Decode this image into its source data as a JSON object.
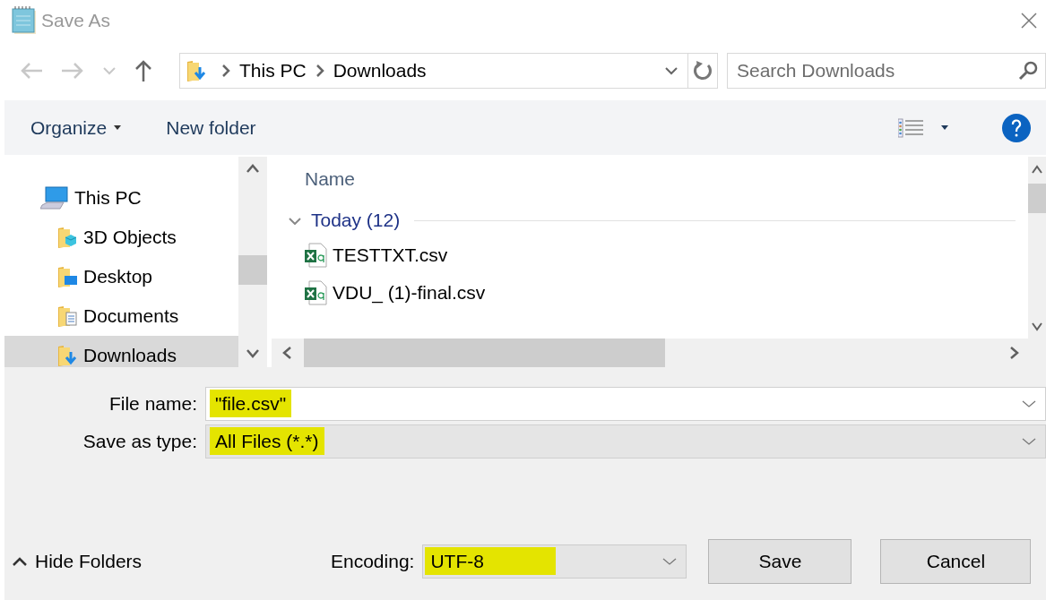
{
  "window": {
    "title": "Save As"
  },
  "address": {
    "path": [
      {
        "label": "This PC"
      },
      {
        "label": "Downloads"
      }
    ]
  },
  "search": {
    "placeholder": "Search Downloads"
  },
  "toolbar": {
    "items": [
      {
        "label": "Organize",
        "has_menu": true
      },
      {
        "label": "New folder",
        "has_menu": false
      }
    ]
  },
  "sidebar": {
    "items": [
      {
        "label": "This PC",
        "kind": "pc",
        "selected": false,
        "children": [
          {
            "label": "3D Objects",
            "kind": "objects",
            "selected": false
          },
          {
            "label": "Desktop",
            "kind": "desktop",
            "selected": false
          },
          {
            "label": "Documents",
            "kind": "documents",
            "selected": false
          },
          {
            "label": "Downloads",
            "kind": "downloads",
            "selected": true
          }
        ]
      }
    ]
  },
  "file_list": {
    "columns": [
      "Name"
    ],
    "groups": [
      {
        "label": "Today (12)",
        "expanded": true,
        "files": [
          {
            "name": "TESTTXT.csv"
          },
          {
            "name": "VDU_ (1)-final.csv"
          }
        ]
      }
    ]
  },
  "form": {
    "fields": [
      {
        "label": "File name:",
        "value": "\"file.csv\"",
        "kind": "text",
        "highlighted": true
      },
      {
        "label": "Save as type:",
        "value": "All Files  (*.*)",
        "kind": "select",
        "highlighted": true
      }
    ]
  },
  "footer": {
    "hide_folders": "Hide Folders",
    "encoding": {
      "label": "Encoding:",
      "value": "UTF-8",
      "highlighted": true
    },
    "buttons": [
      {
        "label": "Save"
      },
      {
        "label": "Cancel"
      }
    ]
  }
}
